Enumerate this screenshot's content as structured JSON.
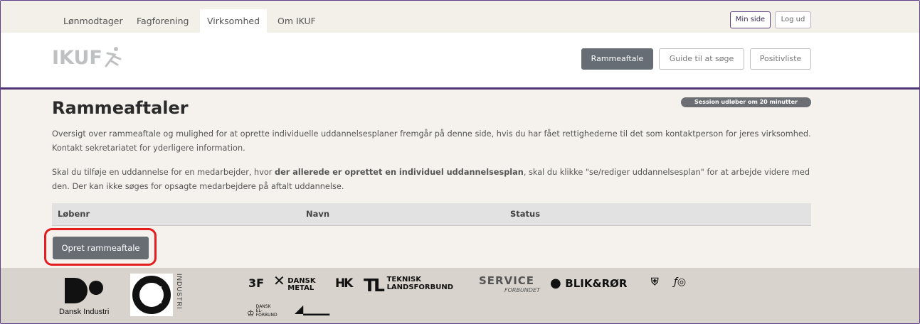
{
  "nav": {
    "tabs": [
      "Lønmodtager",
      "Fagforening",
      "Virksomhed",
      "Om IKUF"
    ],
    "active_tab": "Virksomhed",
    "min_side": "Min side",
    "log_ud": "Log ud"
  },
  "header": {
    "logo_text": "IKUF",
    "buttons": [
      "Rammeaftale",
      "Guide til at søge",
      "Positivliste"
    ]
  },
  "main": {
    "session_badge": "Session udløber om 20 minutter",
    "title": "Rammeaftaler",
    "para1": "Oversigt over rammeaftale og mulighed for at oprette individuelle uddannelsesplaner fremgår på denne side, hvis du har fået rettighederne til det som kontaktperson for jeres virksomhed. Kontakt sekretariatet for yderligere information.",
    "para2_pre": "Skal du tilføje en uddannelse for en medarbejder, hvor ",
    "para2_bold": "der allerede er oprettet en individuel uddannelsesplan",
    "para2_post": ", skal du klikke \"se/rediger uddannelsesplan\" for at arbejde videre med den. Der kan ikke søges for opsagte medarbejdere på aftalt uddannelse.",
    "table_headers": [
      "Løbenr",
      "Navn",
      "Status"
    ],
    "create_button": "Opret rammeaftale"
  },
  "footer": {
    "di_label": "Dansk Industri",
    "industri_label": "INDUSTRI",
    "logos": [
      "3F",
      "DANSK METAL",
      "HK",
      "TEKNISK LANDSFORBUND",
      "SERVICE",
      "FORBUNDET",
      "BLIK&RØR",
      "DANSK EL-FORBUND"
    ]
  },
  "colors": {
    "accent_purple": "#4e3575",
    "button_gray": "#676d73",
    "highlight_red": "#e21e1e",
    "beige_bg": "#f5f1ec",
    "footer_bg": "#d8d3cc"
  }
}
